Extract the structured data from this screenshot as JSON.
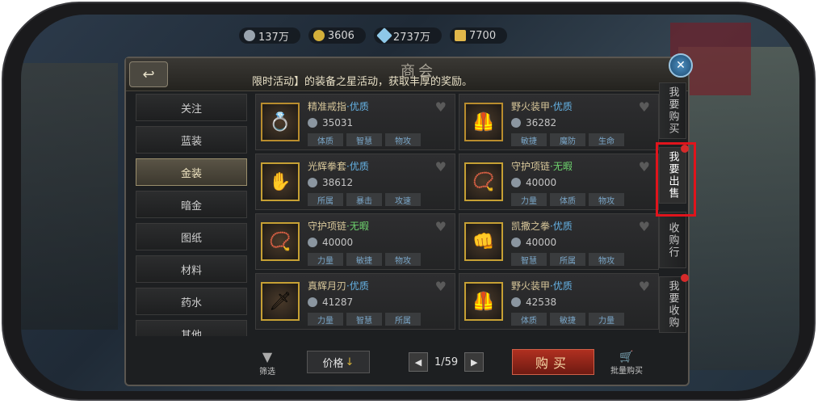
{
  "resources": [
    {
      "value": "137万",
      "icon": "silver-coin-icon",
      "color": "#9aa4ae"
    },
    {
      "value": "3606",
      "icon": "gold-coin-icon",
      "color": "#d4b03a"
    },
    {
      "value": "2737万",
      "icon": "crystal-icon",
      "color": "#8ec8e8"
    },
    {
      "value": "7700",
      "icon": "gold-bar-icon",
      "color": "#e2b84a"
    }
  ],
  "header": {
    "title": "商会",
    "marquee": "限时活动】的装备之星活动，获取丰厚的奖励。",
    "back_icon": "↩",
    "close_icon": "✕"
  },
  "categories": [
    {
      "label": "关注"
    },
    {
      "label": "蓝装"
    },
    {
      "label": "金装"
    },
    {
      "label": "暗金"
    },
    {
      "label": "图纸"
    },
    {
      "label": "材料"
    },
    {
      "label": "药水"
    },
    {
      "label": "其他"
    }
  ],
  "items": [
    {
      "name": "精准戒指",
      "quality": "·优质",
      "price": "35031",
      "icon": "ring-icon",
      "glyph": "💍",
      "tags": [
        "体质",
        "智慧",
        "物攻"
      ]
    },
    {
      "name": "野火装甲",
      "quality": "·优质",
      "price": "36282",
      "icon": "armor-icon",
      "glyph": "🦺",
      "tags": [
        "敏捷",
        "魔防",
        "生命"
      ]
    },
    {
      "name": "光辉拳套",
      "quality": "·优质",
      "price": "38612",
      "icon": "gauntlet-icon",
      "glyph": "✋",
      "tags": [
        "所属",
        "暴击",
        "攻速"
      ]
    },
    {
      "name": "守护项链",
      "quality": "·无暇",
      "price": "40000",
      "icon": "necklace-icon",
      "glyph": "📿",
      "tags": [
        "力量",
        "体质",
        "物攻"
      ]
    },
    {
      "name": "守护项链",
      "quality": "·无暇",
      "price": "40000",
      "icon": "necklace-icon",
      "glyph": "📿",
      "tags": [
        "力量",
        "敏捷",
        "物攻"
      ]
    },
    {
      "name": "凯撒之拳",
      "quality": "·优质",
      "price": "40000",
      "icon": "fist-icon",
      "glyph": "👊",
      "tags": [
        "智慧",
        "所属",
        "物攻"
      ]
    },
    {
      "name": "真辉月刃",
      "quality": "·优质",
      "price": "41287",
      "icon": "blade-icon",
      "glyph": "🗡",
      "tags": [
        "力量",
        "智慧",
        "所属"
      ]
    },
    {
      "name": "野火装甲",
      "quality": "·优质",
      "price": "42538",
      "icon": "armor-icon",
      "glyph": "🦺",
      "tags": [
        "体质",
        "敏捷",
        "力量"
      ]
    }
  ],
  "side_tabs": [
    {
      "label": "我要购买"
    },
    {
      "label": "我要出售"
    },
    {
      "label": "收购行"
    },
    {
      "label": "我要收购"
    }
  ],
  "bottom": {
    "filter_label": "筛选",
    "sort_label": "价格",
    "sort_icon": "↓",
    "page": "1/59",
    "prev_icon": "◀",
    "next_icon": "▶",
    "buy_label": "购买",
    "bulk_label": "批量购买"
  }
}
